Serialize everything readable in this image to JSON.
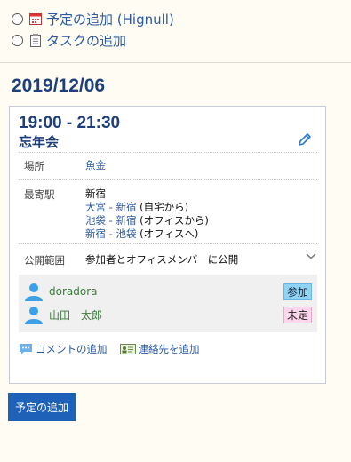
{
  "actions": {
    "add_schedule_label": "予定の追加 (Hignull)",
    "add_task_label": "タスクの追加"
  },
  "date": "2019/12/06",
  "event": {
    "time": "19:00 - 21:30",
    "title": "忘年会",
    "place_label": "場所",
    "place_value": "魚金",
    "station_label": "最寄駅",
    "station_name": "新宿",
    "routes": [
      {
        "route": "大宮 - 新宿",
        "note": "(自宅から)"
      },
      {
        "route": "池袋 - 新宿",
        "note": "(オフィスから)"
      },
      {
        "route": "新宿 - 池袋",
        "note": "(オフィスへ)"
      }
    ],
    "scope_label": "公開範囲",
    "scope_value": "参加者とオフィスメンバーに公開"
  },
  "members": [
    {
      "name": "doradora",
      "status": "参加"
    },
    {
      "name": "山田　太郎",
      "status": "未定"
    }
  ],
  "links": {
    "add_comment": "コメントの追加",
    "add_contact": "連絡先を追加"
  },
  "buttons": {
    "add_schedule": "予定の追加"
  },
  "colors": {
    "accent": "#1d61b8",
    "heading": "#1e3f7a",
    "link": "#2b5aa0",
    "badge_join": "#8fd3f5",
    "badge_undecided": "#ffd6ec"
  },
  "icons": [
    "calendar-icon",
    "clipboard-icon",
    "pencil-icon",
    "chevron-down-icon",
    "user-icon",
    "comment-icon",
    "contact-card-icon"
  ]
}
